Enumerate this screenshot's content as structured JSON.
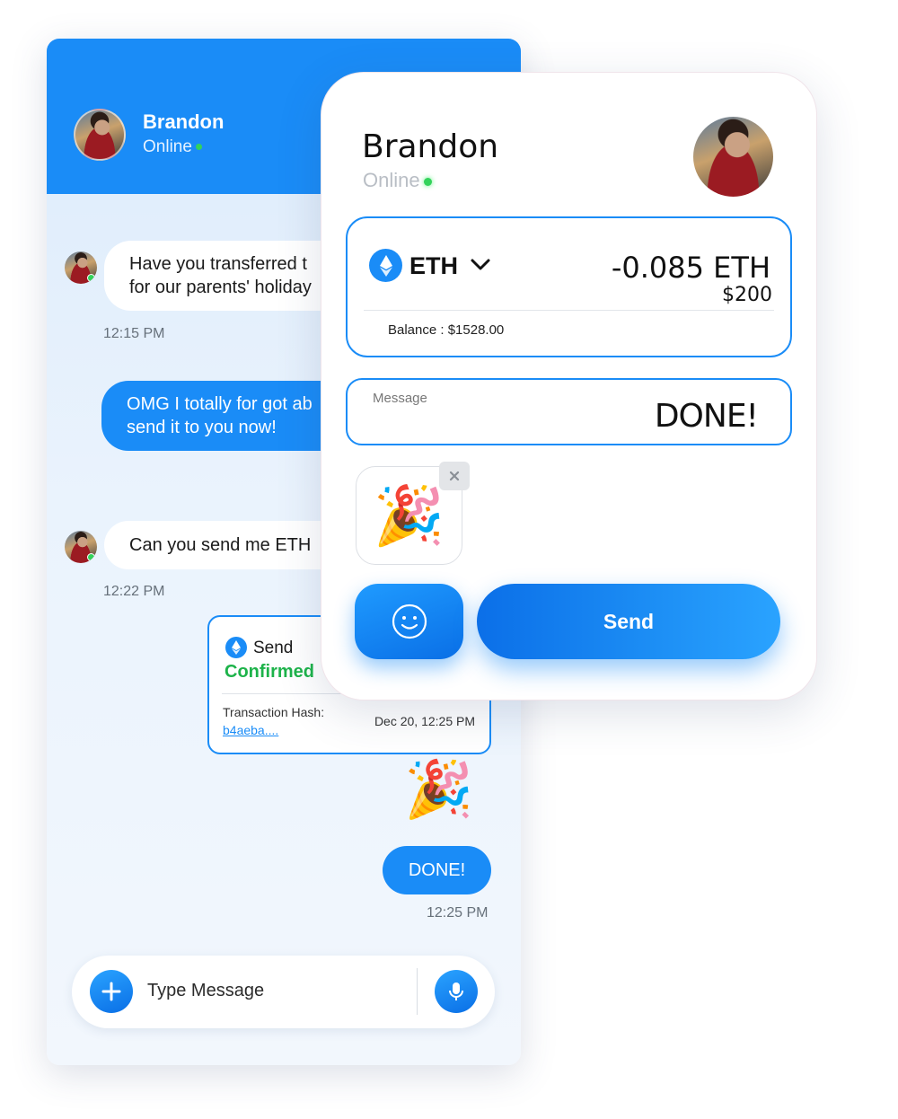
{
  "chat": {
    "contact_name": "Brandon",
    "contact_status": "Online",
    "messages": [
      {
        "direction": "in",
        "lines": [
          "Have you transferred t",
          "for our parents' holiday"
        ],
        "time": "12:15 PM"
      },
      {
        "direction": "out",
        "lines": [
          "OMG I totally for got ab",
          "send it to you now!"
        ]
      },
      {
        "direction": "in",
        "lines": [
          "Can you send me ETH"
        ],
        "time": "12:22 PM"
      },
      {
        "direction": "out",
        "text": "DONE!",
        "time": "12:25 PM"
      }
    ],
    "transaction": {
      "action": "Send",
      "status": "Confirmed",
      "hash_label": "Transaction Hash:",
      "hash": "b4aeba....",
      "date": "Dec 20, 12:25 PM"
    },
    "sticker": "🎉",
    "input_placeholder": "Type Message"
  },
  "payment": {
    "contact_name": "Brandon",
    "contact_status": "Online",
    "token": "ETH",
    "amount_eth": "-0.085 ETH",
    "amount_usd": "$200",
    "balance": "Balance : $1528.00",
    "message_label": "Message",
    "message_value": "DONE!",
    "attachment": "🎉",
    "send_label": "Send"
  },
  "colors": {
    "accent": "#1a8cf7",
    "online": "#33d35b",
    "confirmed": "#1db34a"
  },
  "icons": [
    "eth-icon",
    "chevron-down-icon",
    "close-icon",
    "smiley-icon",
    "plus-icon",
    "microphone-icon"
  ]
}
